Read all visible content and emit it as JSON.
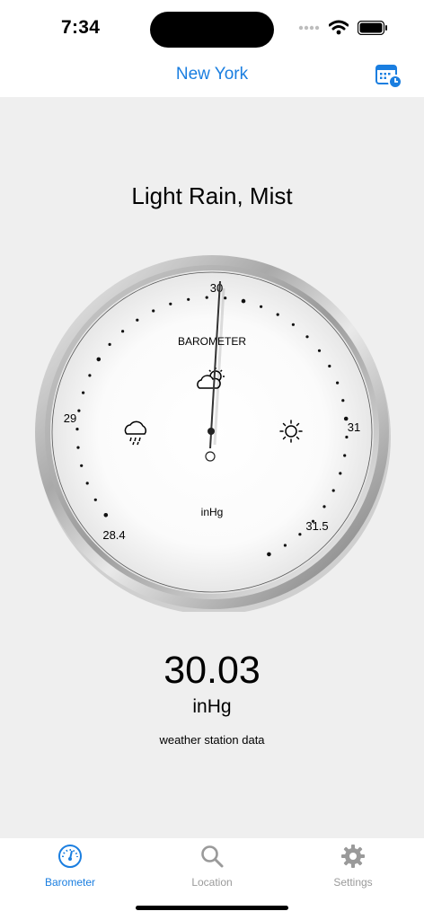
{
  "status": {
    "time": "7:34"
  },
  "nav": {
    "title": "New York",
    "calendar_icon": "calendar-clock-icon"
  },
  "weather": {
    "condition": "Light Rain, Mist"
  },
  "gauge": {
    "title": "BAROMETER",
    "unit_label": "inHg",
    "scale_min": 28.4,
    "scale_max": 31.5,
    "needle_value": 30.03,
    "tick_labels": [
      "28.4",
      "29",
      "30",
      "31",
      "31.5"
    ],
    "icons": [
      "rain-icon",
      "partly-cloudy-icon",
      "sun-icon"
    ]
  },
  "reading": {
    "value": "30.03",
    "unit": "inHg",
    "source": "weather station data"
  },
  "tabs": [
    {
      "label": "Barometer",
      "icon": "gauge-icon",
      "active": true
    },
    {
      "label": "Location",
      "icon": "search-icon",
      "active": false
    },
    {
      "label": "Settings",
      "icon": "gear-icon",
      "active": false
    }
  ],
  "colors": {
    "accent": "#1a7ee0",
    "inactive": "#9a9a9a",
    "background": "#efefef"
  }
}
